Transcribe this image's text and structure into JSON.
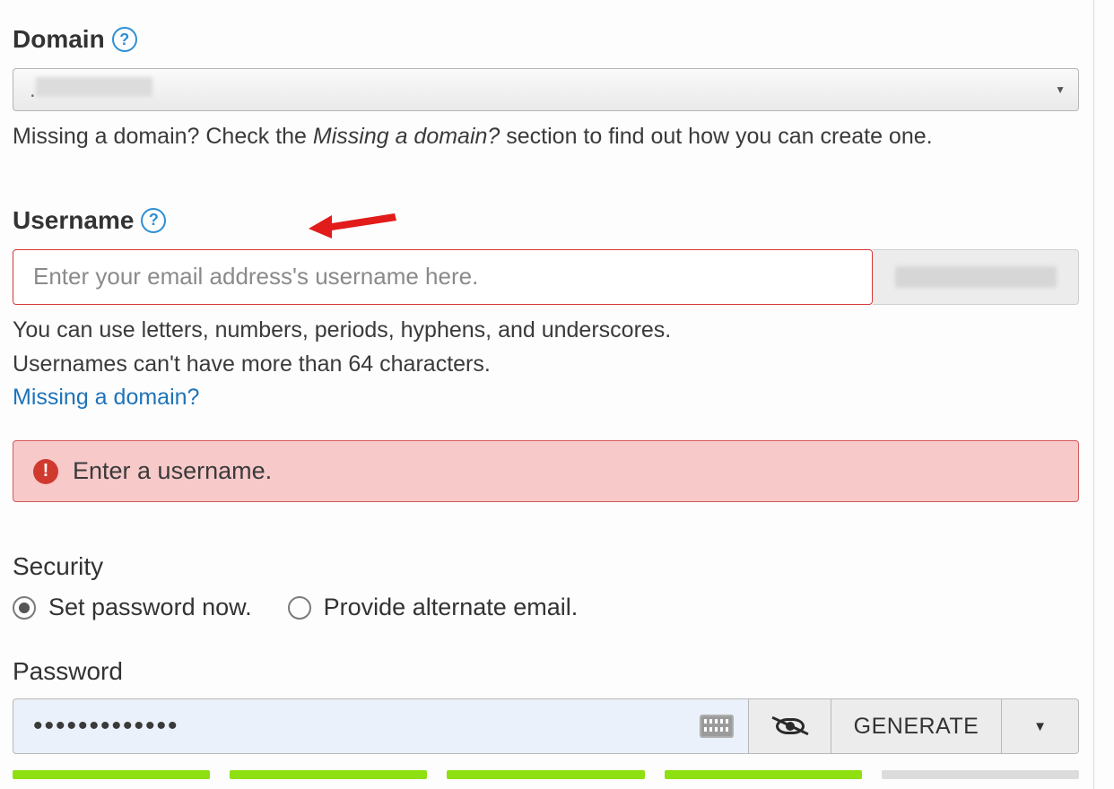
{
  "domain": {
    "label": "Domain",
    "selected_value": ".",
    "helper_prefix": "Missing a domain? Check the ",
    "helper_emphasis": "Missing a domain?",
    "helper_suffix": " section to find out how you can create one."
  },
  "username": {
    "label": "Username",
    "placeholder": "Enter your email address's username here.",
    "helper_line1": "You can use letters, numbers, periods, hyphens, and underscores.",
    "helper_line2": "Usernames can't have more than 64 characters.",
    "missing_link": "Missing a domain?",
    "error_message": "Enter a username."
  },
  "security": {
    "label": "Security",
    "option_set_password": "Set password now.",
    "option_alt_email": "Provide alternate email.",
    "selected": "set_password"
  },
  "password": {
    "label": "Password",
    "value": "•••••••••••••",
    "generate_label": "GENERATE",
    "strength_filled_segments": 4,
    "strength_total_segments": 5
  }
}
